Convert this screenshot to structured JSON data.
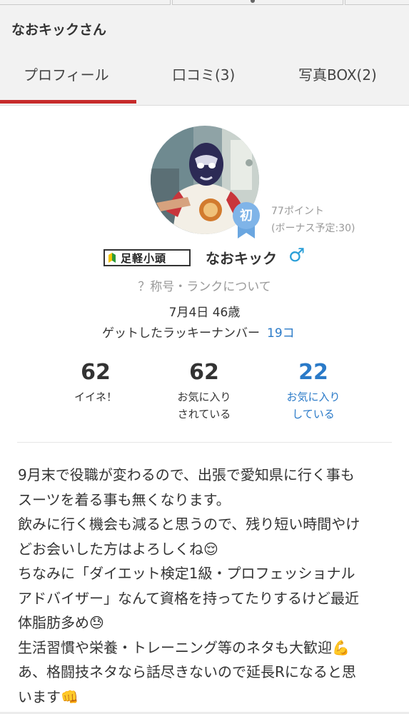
{
  "header": {
    "title": "なおキックさん",
    "tabs": [
      {
        "label": "プロフィール",
        "active": true
      },
      {
        "label": "口コミ(3)",
        "active": false
      },
      {
        "label": "写真BOX(2)",
        "active": false
      }
    ]
  },
  "profile": {
    "beginner_mark": "初",
    "points": "77ポイント",
    "bonus": "(ボーナス予定:30)",
    "rank_title": "足軽小頭",
    "nickname": "なおキック",
    "gender_symbol": "♂",
    "rank_link": "？称号・ランクについて",
    "birth": "7月4日 46歳",
    "lucky_label": "ゲットしたラッキーナンバー",
    "lucky_count": "19コ"
  },
  "stats": [
    {
      "value": "62",
      "line1": "イイネ！",
      "line2": ""
    },
    {
      "value": "62",
      "line1": "お気に入り",
      "line2": "されている"
    },
    {
      "value": "22",
      "line1": "お気に入り",
      "line2": "している"
    }
  ],
  "bio": [
    "9月末で役職が変わるので、出張で愛知県に行く事も",
    "スーツを着る事も無くなります。",
    "飲みに行く機会も減ると思うので、残り短い時間やけ",
    "どお会いした方はよろしくね😌",
    "ちなみに「ダイエット検定1級・プロフェッショナル",
    "アドバイザー」なんて資格を持ってたりするけど最近",
    "体脂肪多め😓",
    "生活習慣や栄養・トレーニング等のネタも大歓迎💪",
    "あ、格闘技ネタなら話尽きないので延長Rになると思",
    "います👊"
  ],
  "colors": {
    "tab_active_underline": "#c62b2b",
    "link_blue": "#2a7ac8",
    "gender_blue": "#2a9fd8",
    "beginner_badge": "#7fb4e8"
  }
}
